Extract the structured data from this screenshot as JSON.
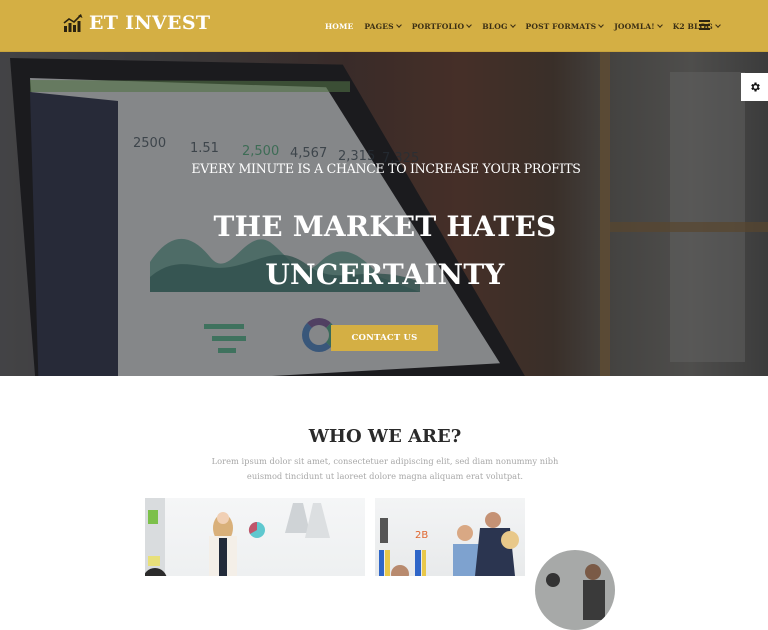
{
  "header": {
    "logo_text": "ET INVEST",
    "logo_icon": "chart-growth-icon",
    "nav": [
      {
        "label": "HOME",
        "active": true,
        "dropdown": false
      },
      {
        "label": "PAGES",
        "active": false,
        "dropdown": true
      },
      {
        "label": "PORTFOLIO",
        "active": false,
        "dropdown": true
      },
      {
        "label": "BLOG",
        "active": false,
        "dropdown": true
      },
      {
        "label": "POST FORMATS",
        "active": false,
        "dropdown": true
      },
      {
        "label": "JOOMLA!",
        "active": false,
        "dropdown": true
      },
      {
        "label": "K2 BLOG",
        "active": false,
        "dropdown": true
      }
    ],
    "menu_icon": "hamburger-icon"
  },
  "hero": {
    "subtitle": "EVERY MINUTE IS A CHANCE TO INCREASE YOUR PROFITS",
    "title_line1": "THE MARKET HATES",
    "title_line2": "UNCERTAINTY",
    "button_label": "CONTACT US",
    "screen_stats": [
      "2500",
      "1.51",
      "2,500",
      "4,567",
      "2,315",
      "7,325"
    ]
  },
  "settings": {
    "icon": "gear-icon"
  },
  "who": {
    "title": "WHO WE ARE?",
    "text": "Lorem ipsum dolor sit amet, consectetuer adipiscing elit, sed diam nonummy nibh euismod tincidunt ut laoreet dolore magna aliquam erat volutpat."
  },
  "colors": {
    "brand": "#d4af44",
    "nav_text": "#3b2f14",
    "heading": "#2a2a2a",
    "body_text": "#a8a8a8"
  }
}
